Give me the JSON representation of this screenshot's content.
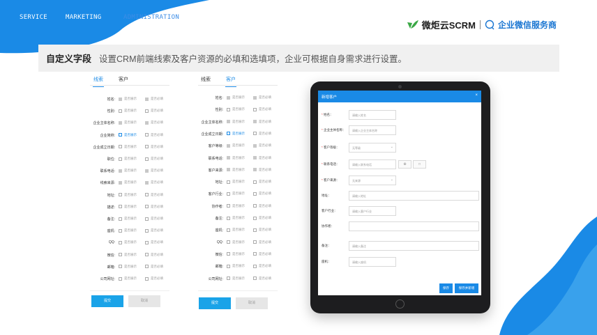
{
  "nav": {
    "service": "SERVICE",
    "marketing": "MARKETING",
    "administration": "ADMINISTRATION"
  },
  "brand": {
    "name": "微炬云SCRM",
    "slogan": "企业微信服务商",
    "logo_icon": "leaf-logo-icon",
    "chat_icon": "chat-bubble-icon",
    "accent": "#1a76d2",
    "logo_color": "#3aa845"
  },
  "banner": {
    "title": "自定义字段",
    "description": "设置CRM前端线索及客户资源的必填和选填项，企业可根据自身需求进行设置。"
  },
  "panel_lead": {
    "tabs": [
      "线索",
      "客户"
    ],
    "active_tab": 0,
    "option_show": "是否展示",
    "option_required": "是否必填",
    "fields": [
      {
        "label": "姓名:",
        "show": "locked",
        "required": "locked"
      },
      {
        "label": "性别:",
        "show": "off",
        "required": "off"
      },
      {
        "label": "企业主体名称:",
        "show": "locked",
        "required": "locked"
      },
      {
        "label": "企业简称:",
        "show": "on",
        "required": "off"
      },
      {
        "label": "企业成立日期:",
        "show": "off",
        "required": "off"
      },
      {
        "label": "职位:",
        "show": "off",
        "required": "off"
      },
      {
        "label": "联系电话:",
        "show": "locked",
        "required": "locked"
      },
      {
        "label": "线索来源:",
        "show": "locked",
        "required": "locked"
      },
      {
        "label": "地址:",
        "show": "off",
        "required": "off"
      },
      {
        "label": "描述:",
        "show": "off",
        "required": "off"
      },
      {
        "label": "备注:",
        "show": "off",
        "required": "off"
      },
      {
        "label": "座机:",
        "show": "off",
        "required": "off"
      },
      {
        "label": "QQ:",
        "show": "off",
        "required": "off"
      },
      {
        "label": "微信:",
        "show": "off",
        "required": "off"
      },
      {
        "label": "邮箱:",
        "show": "off",
        "required": "off"
      },
      {
        "label": "公司网址:",
        "show": "off",
        "required": "off"
      }
    ],
    "confirm_label": "提交",
    "cancel_label": "取消"
  },
  "panel_customer": {
    "tabs": [
      "线索",
      "客户"
    ],
    "active_tab": 1,
    "option_show": "是否展示",
    "option_required": "是否必填",
    "fields": [
      {
        "label": "姓名:",
        "show": "locked",
        "required": "locked"
      },
      {
        "label": "性别:",
        "show": "off",
        "required": "off"
      },
      {
        "label": "企业主体名称:",
        "show": "locked",
        "required": "locked"
      },
      {
        "label": "企业成立日期:",
        "show": "on",
        "required": "off"
      },
      {
        "label": "客户等级:",
        "show": "locked",
        "required": "locked"
      },
      {
        "label": "联系电话:",
        "show": "locked",
        "required": "locked"
      },
      {
        "label": "客户来源:",
        "show": "locked",
        "required": "locked"
      },
      {
        "label": "地址:",
        "show": "off",
        "required": "off"
      },
      {
        "label": "客户行业:",
        "show": "off",
        "required": "off"
      },
      {
        "label": "协作者:",
        "show": "off",
        "required": "off"
      },
      {
        "label": "备注:",
        "show": "off",
        "required": "off"
      },
      {
        "label": "座机:",
        "show": "off",
        "required": "off"
      },
      {
        "label": "QQ:",
        "show": "off",
        "required": "off"
      },
      {
        "label": "微信:",
        "show": "off",
        "required": "off"
      },
      {
        "label": "邮箱:",
        "show": "off",
        "required": "off"
      },
      {
        "label": "公司网址:",
        "show": "off",
        "required": "off"
      }
    ],
    "confirm_label": "提交",
    "cancel_label": "取消"
  },
  "modal": {
    "title": "新增客户",
    "close": "×",
    "fields": [
      {
        "label": "姓名：",
        "required": true,
        "type": "input",
        "placeholder": "请输入姓名"
      },
      {
        "label": "企业主体名称：",
        "required": true,
        "type": "input",
        "placeholder": "请输入企业主体名称"
      },
      {
        "label": "客户等级：",
        "required": true,
        "type": "select",
        "placeholder": "无等级"
      },
      {
        "label": "联系电话：",
        "required": true,
        "type": "phone",
        "placeholder": "请输入联系电话"
      },
      {
        "label": "客户来源：",
        "required": true,
        "type": "select",
        "placeholder": "无来源"
      },
      {
        "label": "地址：",
        "required": false,
        "type": "wide",
        "placeholder": "请输入地址"
      },
      {
        "label": "客户行业：",
        "required": false,
        "type": "input",
        "placeholder": "请输入客户行业"
      },
      {
        "label": "协作者：",
        "required": false,
        "type": "wide",
        "placeholder": ""
      },
      {
        "label": "备注：",
        "required": false,
        "type": "wide",
        "placeholder": "请输入备注"
      },
      {
        "label": "座机：",
        "required": false,
        "type": "input",
        "placeholder": "请输入座机"
      }
    ],
    "phone_add": "⊕",
    "phone_edit": "□",
    "save_label": "保存",
    "save_new_label": "保存并新增"
  }
}
